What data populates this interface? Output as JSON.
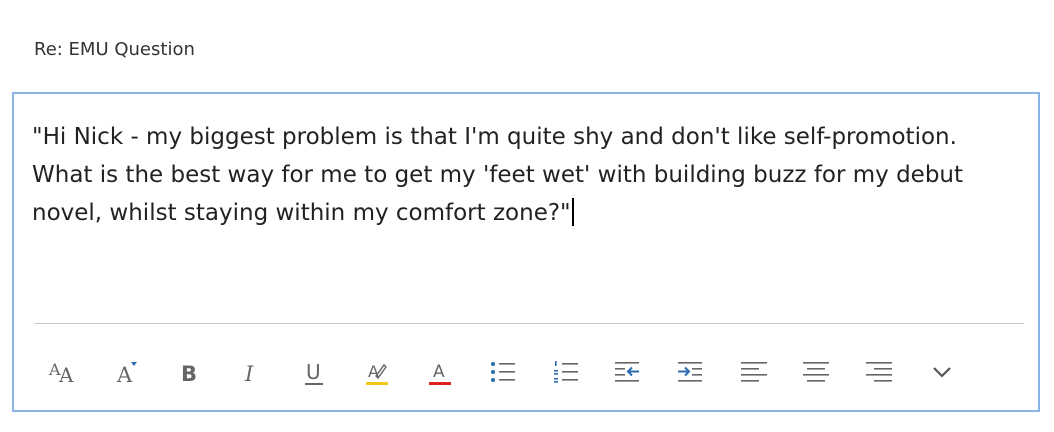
{
  "subject": "Re: EMU Question",
  "body": {
    "text": "\"Hi Nick - my biggest problem is that I'm quite shy and don't like self-promotion. What is the best way for me to get my 'feet wet' with building buzz for my debut novel, whilst staying within my comfort zone?\""
  },
  "toolbar": {
    "bold_label": "B",
    "italic_label": "I",
    "underline_label": "U",
    "font_color_label": "A",
    "buttons": [
      {
        "name": "font-size",
        "icon": "font-size-icon"
      },
      {
        "name": "superscript",
        "icon": "grow-font-icon"
      },
      {
        "name": "bold",
        "icon": "bold-icon"
      },
      {
        "name": "italic",
        "icon": "italic-icon"
      },
      {
        "name": "underline",
        "icon": "underline-icon"
      },
      {
        "name": "highlight",
        "icon": "highlight-icon"
      },
      {
        "name": "font-color",
        "icon": "font-color-icon"
      },
      {
        "name": "bullets",
        "icon": "bulleted-list-icon"
      },
      {
        "name": "numbering",
        "icon": "numbered-list-icon"
      },
      {
        "name": "decrease-indent",
        "icon": "decrease-indent-icon"
      },
      {
        "name": "increase-indent",
        "icon": "increase-indent-icon"
      },
      {
        "name": "align-left",
        "icon": "align-left-icon"
      },
      {
        "name": "align-center",
        "icon": "align-center-icon"
      },
      {
        "name": "align-right",
        "icon": "align-right-icon"
      },
      {
        "name": "more",
        "icon": "chevron-down-icon"
      }
    ]
  },
  "colors": {
    "border": "#8ab4e6",
    "icon": "#666666",
    "highlight": "#f5c518",
    "font_color": "#e02020",
    "list_accent": "#2b6cb0"
  }
}
